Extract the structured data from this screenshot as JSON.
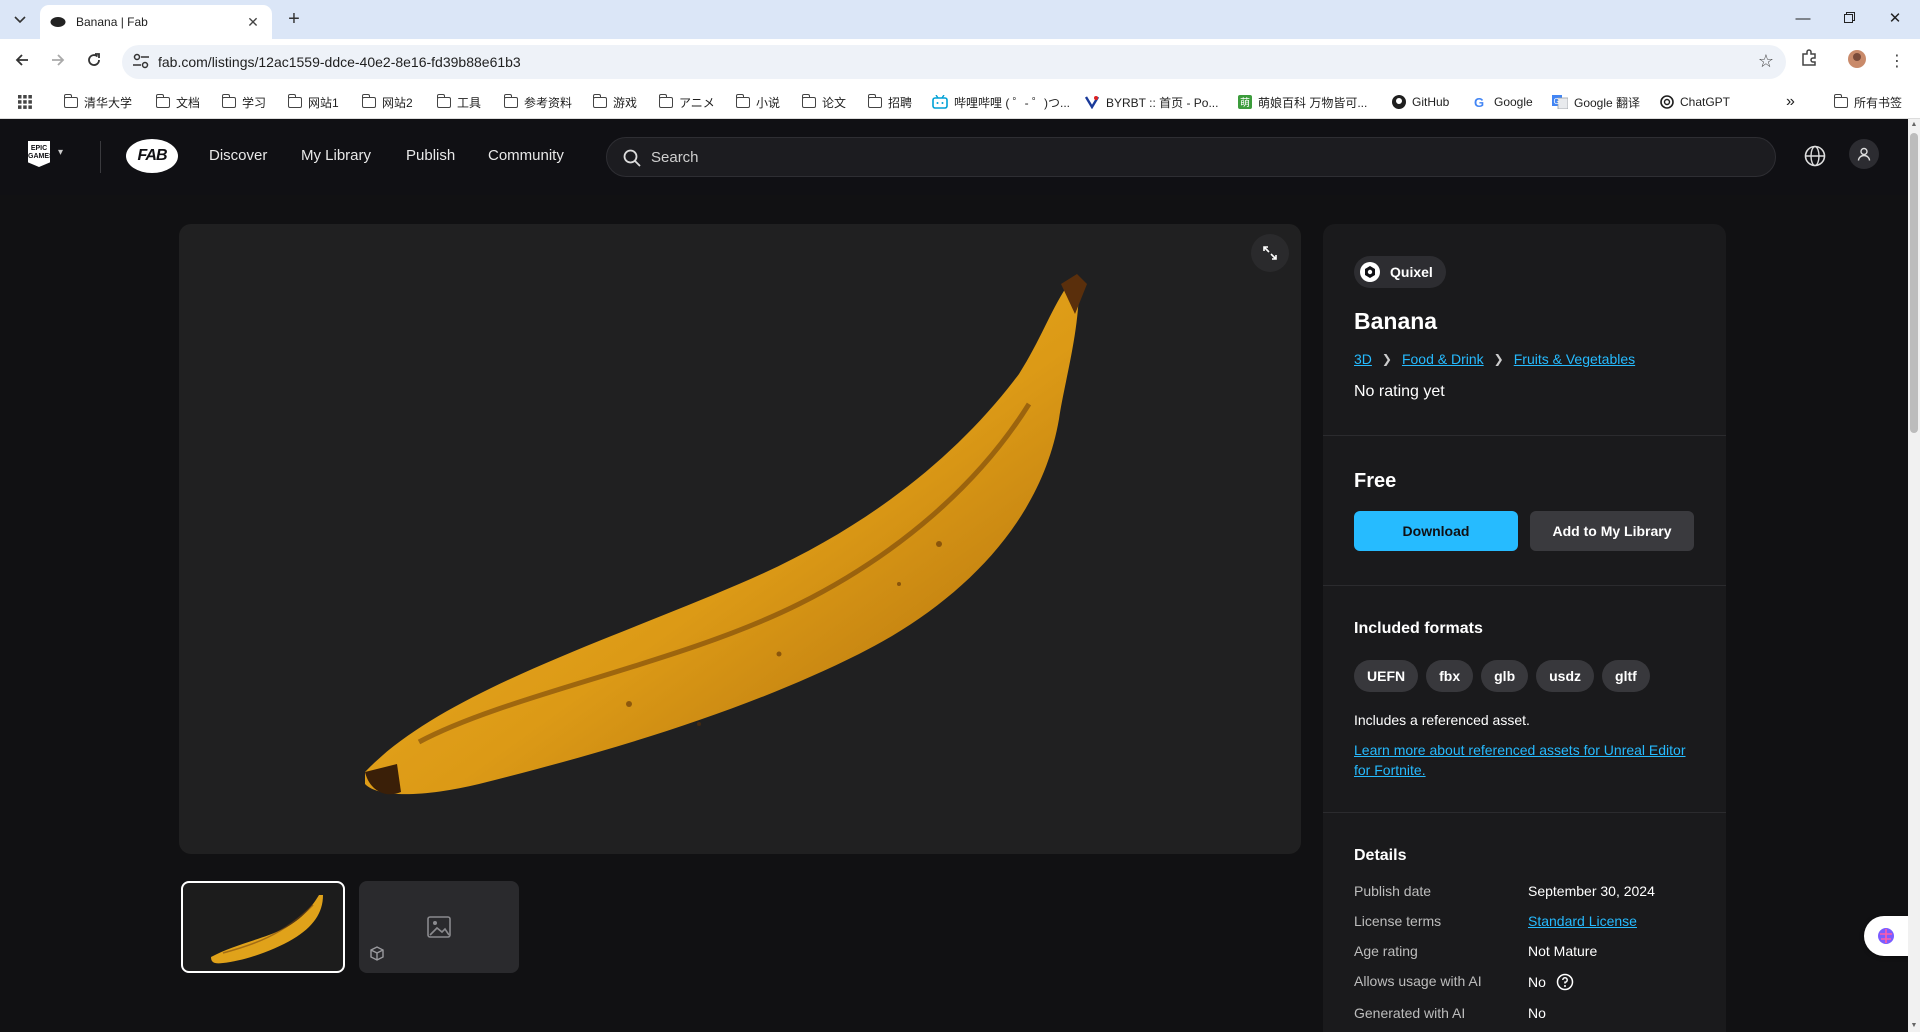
{
  "browser": {
    "tab_title": "Banana | Fab",
    "url": "fab.com/listings/12ac1559-ddce-40e2-8e16-fd39b88e61b3",
    "bookmarks": [
      {
        "label": "清华大学",
        "icon": "folder-icon"
      },
      {
        "label": "文档",
        "icon": "folder-icon"
      },
      {
        "label": "学习",
        "icon": "folder-icon"
      },
      {
        "label": "网站1",
        "icon": "folder-icon"
      },
      {
        "label": "网站2",
        "icon": "folder-icon"
      },
      {
        "label": "工具",
        "icon": "folder-icon"
      },
      {
        "label": "参考资料",
        "icon": "folder-icon"
      },
      {
        "label": "游戏",
        "icon": "folder-icon"
      },
      {
        "label": "アニメ",
        "icon": "folder-icon"
      },
      {
        "label": "小说",
        "icon": "folder-icon"
      },
      {
        "label": "论文",
        "icon": "folder-icon"
      },
      {
        "label": "招聘",
        "icon": "folder-icon"
      },
      {
        "label": "哔哩哔哩 ( ゜- ゜)つ...",
        "icon": "bilibili-icon"
      },
      {
        "label": "BYRBT :: 首页 - Po...",
        "icon": "byrbt-icon"
      },
      {
        "label": "萌娘百科 万物皆可...",
        "icon": "moegirl-icon"
      },
      {
        "label": "GitHub",
        "icon": "github-icon"
      },
      {
        "label": "Google",
        "icon": "google-icon"
      },
      {
        "label": "Google 翻译",
        "icon": "google-translate-icon"
      },
      {
        "label": "ChatGPT",
        "icon": "chatgpt-icon"
      }
    ],
    "all_bookmarks": "所有书签"
  },
  "fab_nav": {
    "epic_logo_text": "EPIC GAMES",
    "fab_logo_text": "FAB",
    "links": [
      "Discover",
      "My Library",
      "Publish",
      "Community"
    ],
    "search_placeholder": "Search"
  },
  "listing": {
    "publisher": "Quixel",
    "title": "Banana",
    "breadcrumbs": [
      "3D",
      "Food & Drink",
      "Fruits & Vegetables"
    ],
    "rating": "No rating yet",
    "price": "Free",
    "download_label": "Download",
    "add_library_label": "Add to My Library",
    "formats_title": "Included formats",
    "formats": [
      "UEFN",
      "fbx",
      "glb",
      "usdz",
      "gltf"
    ],
    "ref_note": "Includes a referenced asset.",
    "ref_link": "Learn more about referenced assets for Unreal Editor for Fortnite.",
    "details_title": "Details",
    "details": [
      {
        "key": "Publish date",
        "value": "September 30, 2024"
      },
      {
        "key": "License terms",
        "value": "Standard License"
      },
      {
        "key": "Age rating",
        "value": "Not Mature"
      },
      {
        "key": "Allows usage with AI",
        "value": "No"
      },
      {
        "key": "Generated with AI",
        "value": "No"
      }
    ]
  },
  "colors": {
    "accent": "#26bbff",
    "page_bg": "#111113",
    "panel_bg": "#1a1a1c",
    "banana": "#e0a21a"
  }
}
